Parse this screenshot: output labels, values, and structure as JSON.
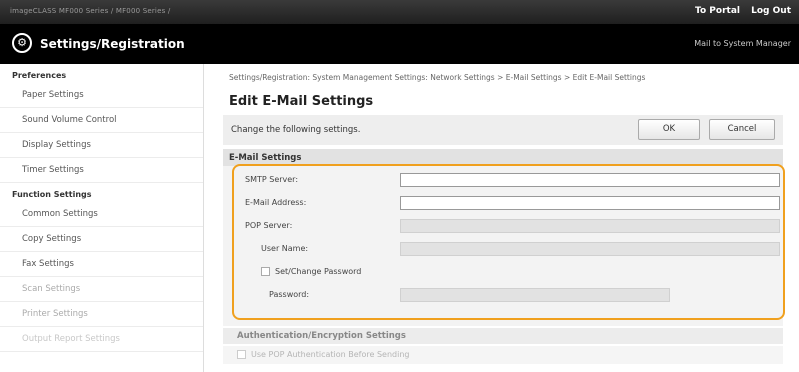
{
  "topbar": {
    "crumb": "imageCLASS    MF000 Series / MF000 Series /",
    "portal_link": "To Portal",
    "logout_link": "Log Out"
  },
  "header": {
    "logo_icon": "settings-gear-icon",
    "title": "Settings/Registration",
    "mail_link": "Mail to System Manager"
  },
  "sidebar": {
    "groups": [
      {
        "heading": "Preferences",
        "items": [
          "Paper Settings",
          "Sound Volume Control",
          "Display Settings",
          "Timer Settings"
        ]
      },
      {
        "heading": "Function Settings",
        "items": [
          "Common Settings",
          "Copy Settings",
          "Fax Settings",
          "Scan Settings",
          "Printer Settings",
          "Output Report Settings"
        ]
      }
    ]
  },
  "main": {
    "breadcrumb": "Settings/Registration: System Management Settings: Network Settings > E-Mail Settings > Edit E-Mail Settings",
    "title": "Edit E-Mail Settings",
    "instruction": "Change the following settings.",
    "ok_label": "OK",
    "cancel_label": "Cancel",
    "section_title": "E-Mail Settings",
    "fields": {
      "smtp_label": "SMTP Server:",
      "smtp_value": "",
      "email_label": "E-Mail Address:",
      "email_value": "",
      "pop_label": "POP Server:",
      "pop_value": "",
      "username_label": "User Name:",
      "username_value": "",
      "set_password_label": "Set/Change Password",
      "set_password_checked": false,
      "password_label": "Password:",
      "password_value": ""
    },
    "section2_title": "Authentication/Encryption Settings",
    "pop_auth_label": "Use POP Authentication Before Sending",
    "pop_auth_checked": false
  },
  "colors": {
    "highlight": "#f0a01e",
    "topbar": "#2a2a2a",
    "header": "#000000"
  }
}
